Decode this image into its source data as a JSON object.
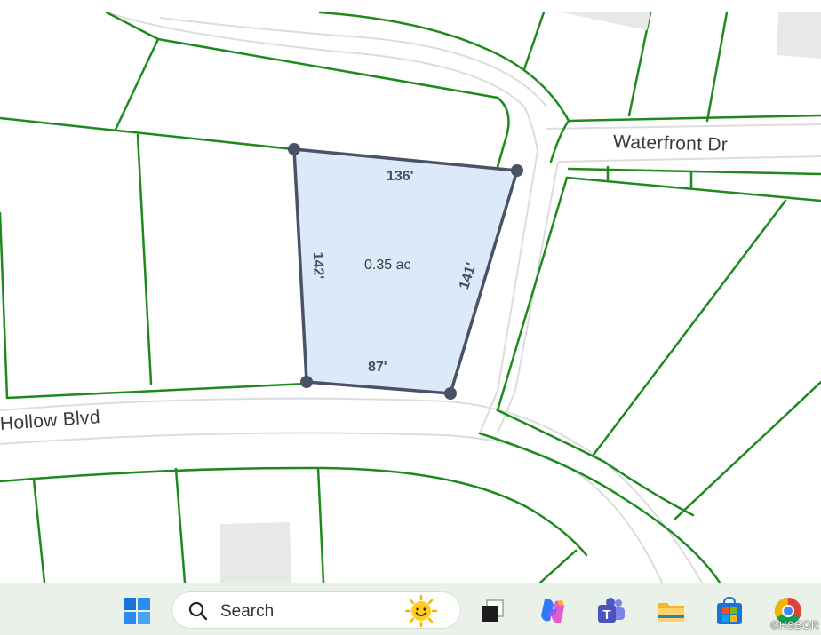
{
  "map": {
    "roads": {
      "waterfront": "Waterfront Dr",
      "hollow": "Hollow Blvd"
    },
    "parcel": {
      "area": "0.35 ac",
      "dimensions": {
        "north": "136'",
        "west": "142'",
        "east": "141'",
        "south": "87'"
      },
      "fill_color": "#dce9f8",
      "outline_color": "#4a5266"
    },
    "lot_line_color": "#1e8a1e",
    "road_color": "#e2e2e2"
  },
  "taskbar": {
    "search_placeholder": "Search",
    "icons": [
      "windows-start-icon",
      "search-icon",
      "weather-sun-icon",
      "task-view-icon",
      "copilot-icon",
      "teams-icon",
      "file-explorer-icon",
      "microsoft-store-icon",
      "chrome-icon"
    ]
  },
  "watermark": "©HSBOR"
}
